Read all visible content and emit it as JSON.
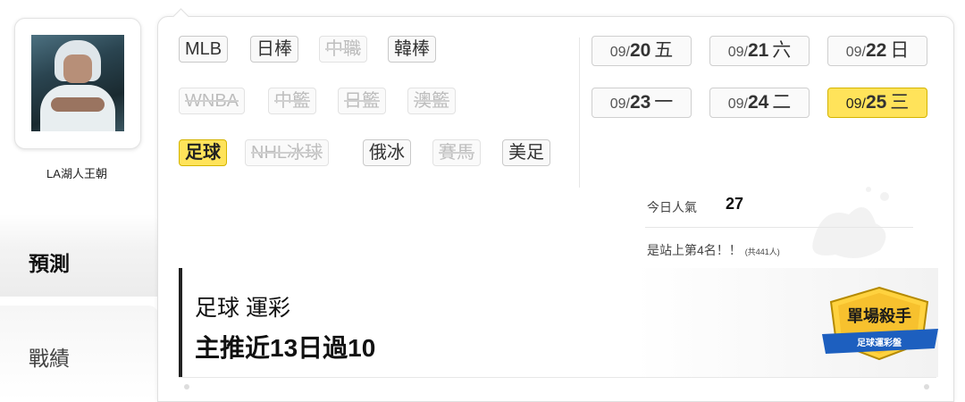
{
  "user": {
    "name": "LA湖人王朝"
  },
  "sidebar": {
    "tabs": [
      {
        "label": "預測"
      },
      {
        "label": "戰績"
      }
    ]
  },
  "leagues": [
    {
      "label": "MLB",
      "state": "on"
    },
    {
      "label": "日棒",
      "state": "on"
    },
    {
      "label": "中職",
      "state": "off"
    },
    {
      "label": "韓棒",
      "state": "on"
    },
    {
      "label": "WNBA",
      "state": "off"
    },
    {
      "label": "中籃",
      "state": "off"
    },
    {
      "label": "日籃",
      "state": "off"
    },
    {
      "label": "澳籃",
      "state": "off"
    },
    {
      "label": "足球",
      "state": "selected"
    },
    {
      "label": "NHL冰球",
      "state": "off"
    },
    {
      "label": "俄冰",
      "state": "on"
    },
    {
      "label": "賽馬",
      "state": "off"
    },
    {
      "label": "美足",
      "state": "on"
    }
  ],
  "dates": [
    {
      "month": "09/",
      "day": "20",
      "weekday": "五",
      "selected": false
    },
    {
      "month": "09/",
      "day": "21",
      "weekday": "六",
      "selected": false
    },
    {
      "month": "09/",
      "day": "22",
      "weekday": "日",
      "selected": false
    },
    {
      "month": "09/",
      "day": "23",
      "weekday": "一",
      "selected": false
    },
    {
      "month": "09/",
      "day": "24",
      "weekday": "二",
      "selected": false
    },
    {
      "month": "09/",
      "day": "25",
      "weekday": "三",
      "selected": true
    }
  ],
  "popularity": {
    "label": "今日人氣",
    "value": "27",
    "rank_text": "是站上第4名！！",
    "rank_total": "(共441人)"
  },
  "card": {
    "title": "足球 運彩",
    "stat": "主推近13日過10",
    "badge_title": "單場殺手",
    "badge_sub": "足球運彩盤"
  },
  "colors": {
    "selected": "#ffe35a",
    "accent_border": "#d4b400",
    "badge_blue": "#1d5fbf"
  }
}
